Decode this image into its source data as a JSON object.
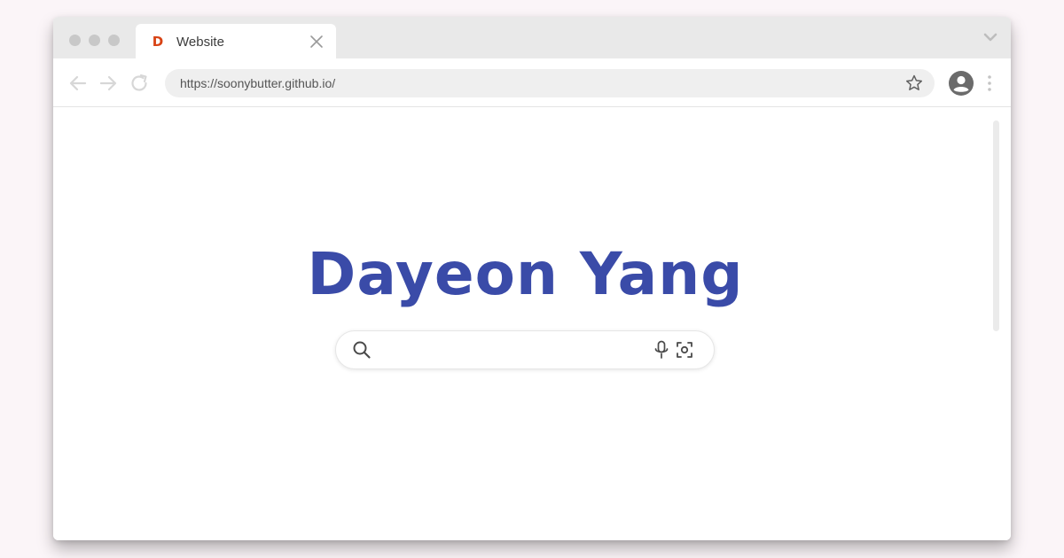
{
  "tab": {
    "title": "Website",
    "favicon_letter": "D",
    "favicon_color": "#d84315"
  },
  "toolbar": {
    "url": "https://soonybutter.github.io/",
    "icons": [
      "back-arrow-icon",
      "forward-arrow-icon",
      "reload-icon",
      "star-icon",
      "account-icon",
      "more-vert-icon"
    ]
  },
  "page": {
    "heading": "Dayeon Yang",
    "heading_color": "#3a4ba8",
    "search": {
      "placeholder": "",
      "value": "",
      "icons": [
        "search-icon",
        "microphone-icon",
        "image-search-icon"
      ]
    }
  }
}
